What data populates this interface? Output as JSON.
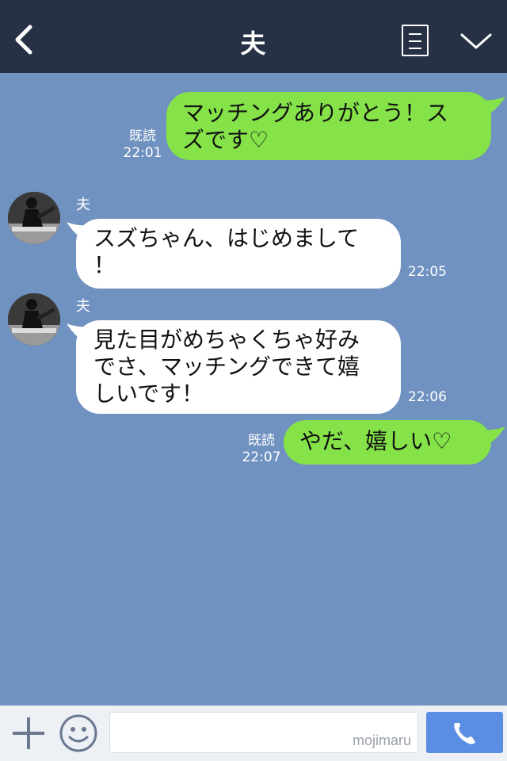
{
  "header": {
    "title": "夫"
  },
  "messages": [
    {
      "direction": "out",
      "lines": [
        "マッチングありがとう！ス",
        "ズです♡"
      ],
      "read": "既読",
      "time": "22:01"
    },
    {
      "direction": "in",
      "sender": "夫",
      "lines": [
        "スズちゃん、はじめまして",
        "！"
      ],
      "time": "22:05"
    },
    {
      "direction": "in",
      "sender": "夫",
      "lines": [
        "見た目がめちゃくちゃ好み",
        "でさ、マッチングできて嬉",
        "しいです！"
      ],
      "time": "22:06"
    },
    {
      "direction": "out",
      "lines": [
        "やだ、嬉しい♡"
      ],
      "read": "既読",
      "time": "22:07"
    }
  ],
  "input": {
    "placeholder": "",
    "watermark": "mojimaru"
  },
  "colors": {
    "header_bg": "#263146",
    "chat_bg": "#7092c0",
    "outgoing_bubble": "#85e249",
    "incoming_bubble": "#ffffff",
    "call_button": "#5a8ee4"
  },
  "icons": {
    "back": "chevron-left-icon",
    "menu": "list-icon",
    "collapse": "chevron-down-icon",
    "plus": "plus-icon",
    "emoji": "smiley-icon",
    "call": "phone-icon"
  }
}
